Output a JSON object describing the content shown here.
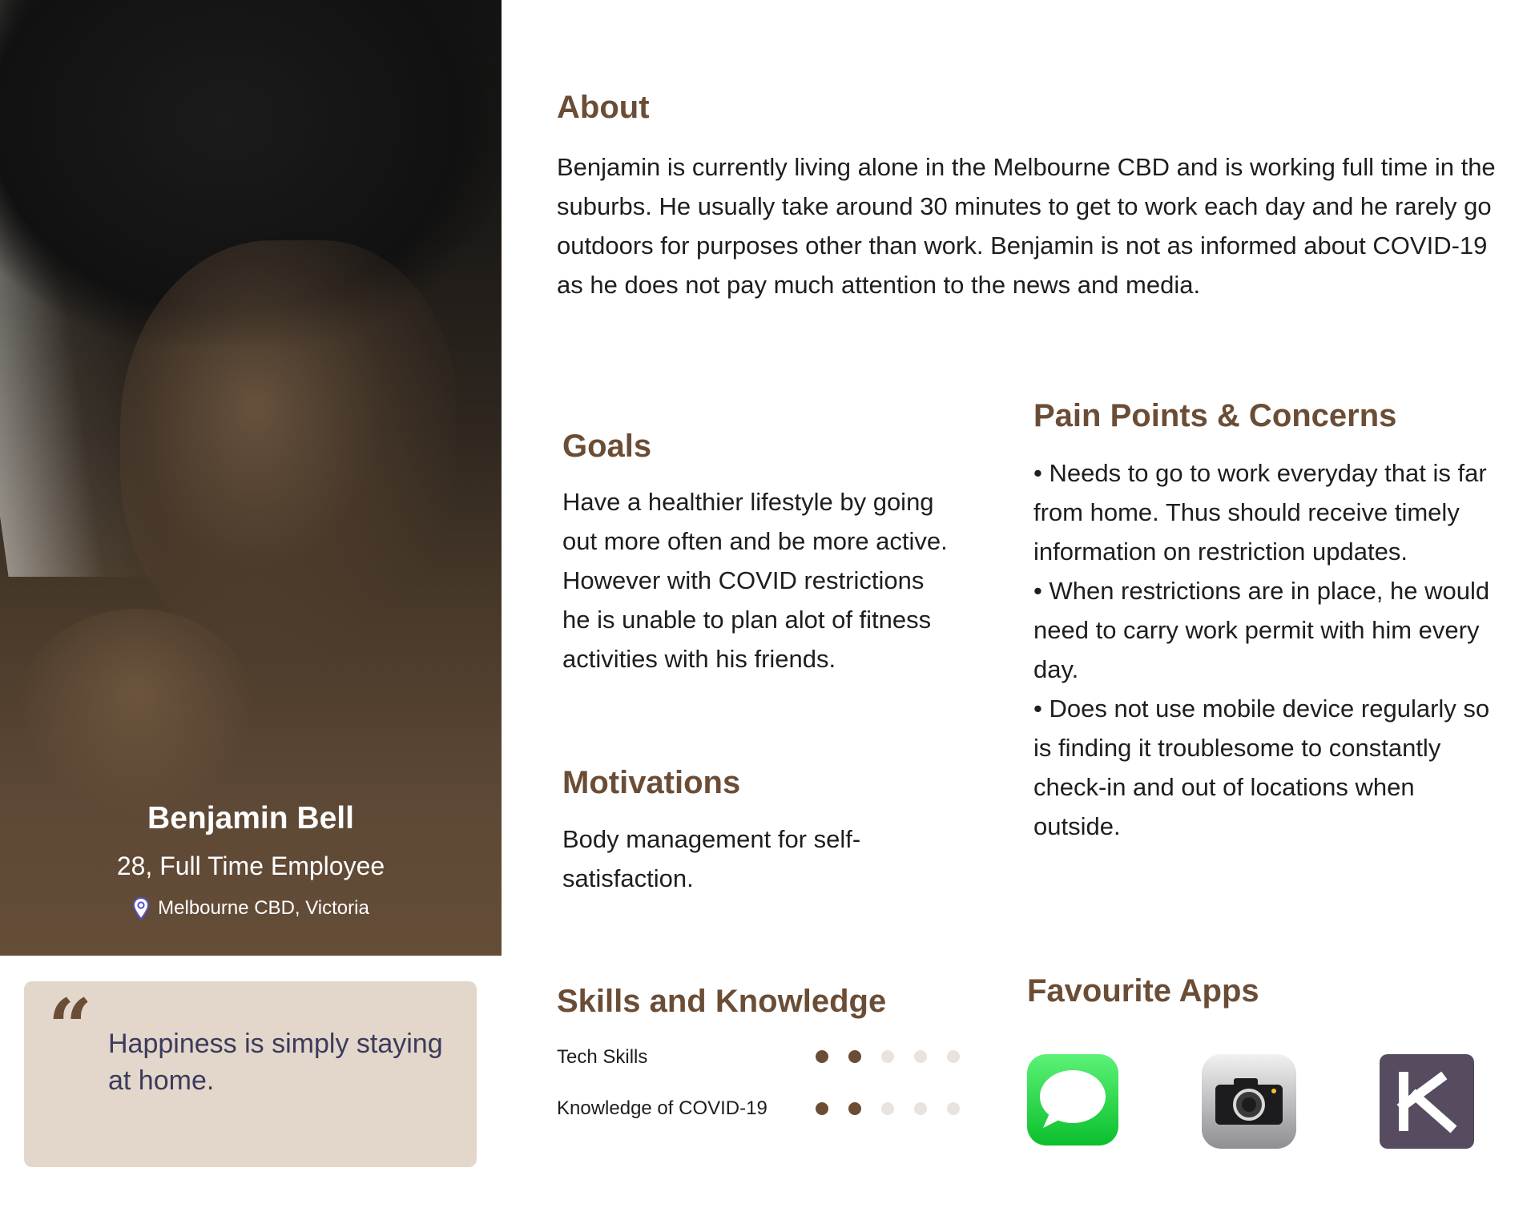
{
  "profile": {
    "name": "Benjamin Bell",
    "role": "28, Full Time Employee",
    "location": "Melbourne CBD, Victoria",
    "quote": "Happiness is simply staying at home."
  },
  "about": {
    "title": "About",
    "text": "Benjamin is currently living alone in the Melbourne CBD and is working full time in the suburbs. He usually take around 30 minutes to get to work each day and he rarely go outdoors for purposes other than work. Benjamin is not as informed about COVID-19 as he does not pay much attention to the news and media."
  },
  "goals": {
    "title": "Goals",
    "text": "Have a healthier lifestyle by going out more often and be more active. However with COVID restrictions he is unable to plan alot of fitness activities with his friends."
  },
  "motivations": {
    "title": "Motivations",
    "text": "Body management for self-satisfaction."
  },
  "pain_points": {
    "title": "Pain Points & Concerns",
    "items": [
      "• Needs to go to work everyday that is far from home. Thus should receive timely information on restriction updates.",
      "• When restrictions are in place, he would need to carry work permit with him every day.",
      "• Does not use mobile device regularly so is finding it troublesome to constantly check-in and out of locations when outside."
    ]
  },
  "skills": {
    "title": "Skills and Knowledge",
    "items": [
      {
        "label": "Tech Skills",
        "level": 2,
        "max": 5
      },
      {
        "label": "Knowledge of COVID-19",
        "level": 2,
        "max": 5
      }
    ]
  },
  "apps": {
    "title": "Favourite Apps",
    "items": [
      "messages-app-icon",
      "camera-app-icon",
      "keep-app-icon"
    ]
  },
  "colors": {
    "accent": "#6b4d36",
    "quote_bg": "#e3d6ca",
    "quote_text": "#3a3b5c",
    "dot_off": "#e9e3de"
  }
}
